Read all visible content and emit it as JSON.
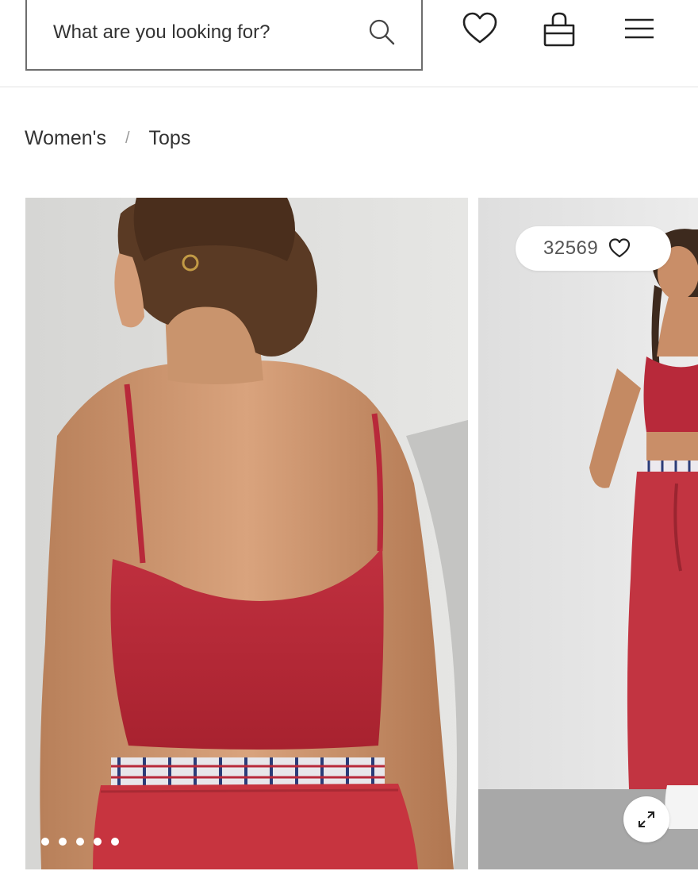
{
  "header": {
    "search": {
      "placeholder": "What are you looking for?",
      "value": ""
    },
    "icons": {
      "search": "search-icon",
      "wishlist": "heart-icon",
      "bag": "shopping-bag-icon",
      "menu": "hamburger-menu-icon"
    }
  },
  "breadcrumb": {
    "items": [
      "Women's",
      "Tops"
    ],
    "separator": "/"
  },
  "gallery": {
    "images": [
      {
        "alt": ""
      },
      {
        "alt": ""
      }
    ],
    "likes": {
      "count": "32569",
      "icon": "heart-outline-icon"
    },
    "pagination": {
      "total": 5,
      "active": 1
    },
    "expand_icon": "expand-arrows-icon"
  },
  "colors": {
    "border": "#6e6e6e",
    "divider": "#e2e2e2",
    "text": "#333333",
    "garment_red": "#b8293a"
  }
}
